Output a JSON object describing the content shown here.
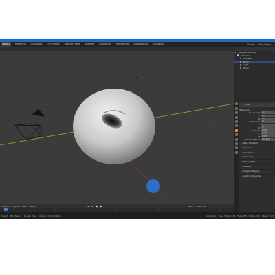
{
  "app": {
    "menubar_tabs": [
      "Layout",
      "Modeling",
      "Sculpting",
      "UV Editing",
      "Texture Paint",
      "Shading",
      "Animation",
      "Rendering",
      "Compositing",
      "Scripting"
    ],
    "active_tab": "Layout",
    "scene_label": "Scene",
    "view_layer_label": "View Layer"
  },
  "viewport": {
    "object": "torus",
    "object_color": "#d8d8d8",
    "camera": true,
    "light": true,
    "x_axis_color": "#9ea82a",
    "y_axis_color": "#9b3232"
  },
  "outliner": {
    "items": [
      {
        "label": "Scene Collection",
        "selected": false
      },
      {
        "label": "Collection",
        "selected": false
      },
      {
        "label": "Camera",
        "selected": false
      },
      {
        "label": "Torus",
        "selected": true
      },
      {
        "label": "Light",
        "selected": false
      },
      {
        "label": "Torus",
        "selected": false
      }
    ]
  },
  "properties": {
    "object_name": "Torus",
    "transform_title": "Transform",
    "fields": [
      {
        "label": "Location X",
        "value": "0 m"
      },
      {
        "label": "Y",
        "value": "0 m"
      },
      {
        "label": "Z",
        "value": "0 m"
      },
      {
        "label": "Rotation X",
        "value": "0°"
      },
      {
        "label": "Y",
        "value": "0°"
      },
      {
        "label": "Z",
        "value": "0°"
      },
      {
        "label": "Scale X",
        "value": "1.000"
      },
      {
        "label": "Y",
        "value": "1.000"
      },
      {
        "label": "Z",
        "value": "1.000"
      }
    ],
    "mode_label": "Rotation Mode",
    "mode_value": "XYZ Euler",
    "sections": [
      "Delta Transform",
      "Relations",
      "Collections",
      "Instancing",
      "Motion Paths",
      "Visibility",
      "Viewport Display",
      "Custom Properties"
    ]
  },
  "timeline": {
    "labels": [
      "Playback",
      "Keying",
      "View",
      "Marker"
    ],
    "start_label": "Start",
    "start_value": "1",
    "end_label": "End",
    "end_value": "250",
    "current_frame": "1"
  },
  "statusbar": {
    "items": [
      "Select",
      "Box Select",
      "Rotate View",
      "Object Context Menu"
    ],
    "stats": "Collection | Torus | Verts:576 | Faces:576 | Tris:1,152 | Objects:1/3"
  }
}
